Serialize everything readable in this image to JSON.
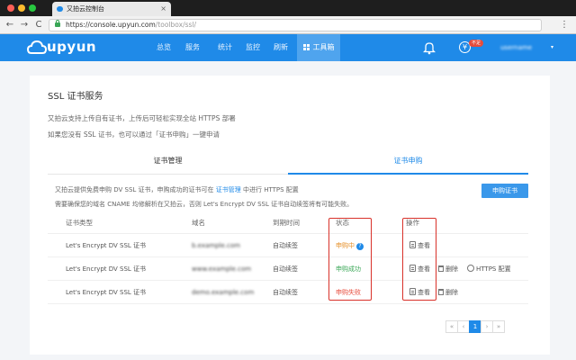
{
  "browser": {
    "tab_title": "又拍云控制台",
    "tab_close": "×",
    "url_host": "https://console.upyun.com",
    "url_path": "/toolbox/ssl/",
    "nav_back": "←",
    "nav_forward": "→",
    "nav_reload": "C",
    "menu": "⋮"
  },
  "header": {
    "logo_text": "upyun",
    "nav": [
      {
        "label": "总览"
      },
      {
        "label": "服务"
      },
      {
        "label": "统计"
      },
      {
        "label": "监控"
      },
      {
        "label": "刷新"
      },
      {
        "label": "工具箱"
      }
    ],
    "yen_symbol": "¥",
    "badge": "不足",
    "user": "username",
    "user_caret": "▾"
  },
  "card": {
    "title": "SSL 证书服务",
    "intro_line1": "又拍云支持上传自有证书，上传后可轻松实现全站 HTTPS 部署",
    "intro_line2": "如果您没有 SSL 证书，也可以通过「证书申购」一键申请",
    "tabs": [
      {
        "label": "证书管理",
        "active": false
      },
      {
        "label": "证书申购",
        "active": true
      }
    ],
    "notice_line1_a": "又拍云提供免费申购 DV SSL 证书，申购成功的证书可在",
    "notice_line1_link": "证书管理",
    "notice_line1_b": "中进行 HTTPS 配置",
    "notice_line2": "需要确保您的域名 CNAME 均修解析在又拍云，否则 Let's Encrypt DV SSL 证书自动续签将有可能失败。",
    "apply_button": "申购证书"
  },
  "table": {
    "headers": {
      "type": "证书类型",
      "domain": "域名",
      "expiry": "到期时间",
      "status": "状态",
      "actions": "操作"
    },
    "rows": [
      {
        "type": "Let's Encrypt DV SSL 证书",
        "domain": "b.example.com",
        "expiry": "自动续签",
        "status": "申购中",
        "help": "?",
        "view": "查看",
        "delete": "",
        "https": ""
      },
      {
        "type": "Let's Encrypt DV SSL 证书",
        "domain": "www.example.com",
        "expiry": "自动续签",
        "status": "申购成功",
        "help": "",
        "view": "查看",
        "delete": "删除",
        "https": "HTTPS 配置"
      },
      {
        "type": "Let's Encrypt DV SSL 证书",
        "domain": "demo.example.com",
        "expiry": "自动续签",
        "status": "申购失败",
        "help": "",
        "view": "查看",
        "delete": "删除",
        "https": ""
      }
    ]
  },
  "pagination": {
    "first": "«",
    "prev": "‹",
    "current": "1",
    "next": "›",
    "last": "»"
  },
  "colors": {
    "brand": "#1f8ae8",
    "highlight_box": "#d9322a",
    "pending": "#e58e26",
    "success": "#3aa757",
    "failed": "#e74c3c"
  }
}
